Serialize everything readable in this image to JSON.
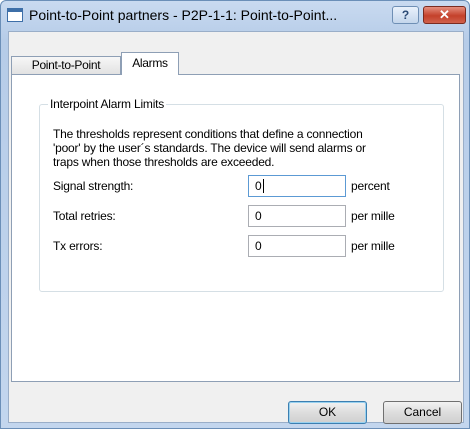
{
  "window": {
    "title": "Point-to-Point partners - P2P-1-1: Point-to-Point...",
    "help_label": "?",
    "close_label": "✕"
  },
  "tabs": [
    {
      "label": "Point-to-Point",
      "active": false
    },
    {
      "label": "Alarms",
      "active": true
    }
  ],
  "group": {
    "title": "Interpoint Alarm Limits",
    "description_lines": [
      "The thresholds represent conditions that define a connection",
      "'poor' by the user´s standards. The device will send alarms or",
      "traps when those thresholds are exceeded."
    ]
  },
  "fields": [
    {
      "label": "Signal strength:",
      "value": "0",
      "unit": "percent"
    },
    {
      "label": "Total retries:",
      "value": "0",
      "unit": "per mille"
    },
    {
      "label": "Tx errors:",
      "value": "0",
      "unit": "per mille"
    }
  ],
  "buttons": {
    "ok_label": "OK",
    "cancel_label": "Cancel"
  }
}
